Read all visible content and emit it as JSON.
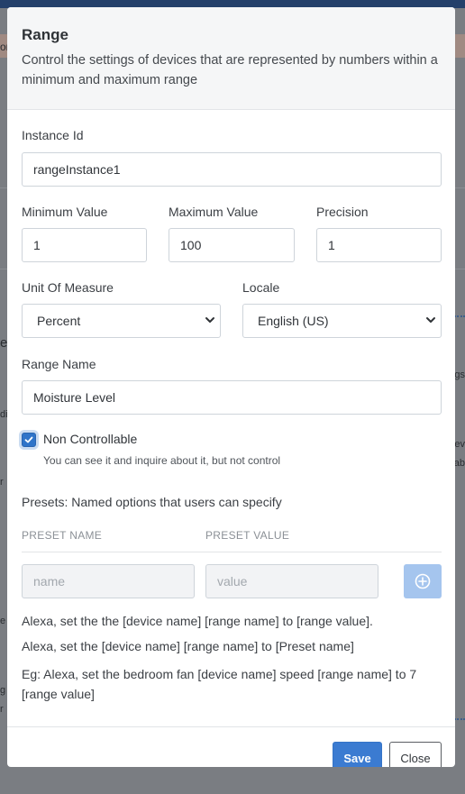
{
  "background": {
    "fragments": [
      "on",
      "e",
      "dit",
      "r",
      "e s",
      "g",
      "r",
      "gs",
      "ev",
      "ab"
    ]
  },
  "modal": {
    "title": "Range",
    "description": "Control the settings of devices that are represented by numbers within a minimum and maximum range"
  },
  "form": {
    "instance_id": {
      "label": "Instance Id",
      "value": "rangeInstance1"
    },
    "minimum_value": {
      "label": "Minimum Value",
      "value": "1"
    },
    "maximum_value": {
      "label": "Maximum Value",
      "value": "100"
    },
    "precision": {
      "label": "Precision",
      "value": "1"
    },
    "unit_of_measure": {
      "label": "Unit Of Measure",
      "selected": "Percent"
    },
    "locale": {
      "label": "Locale",
      "selected": "English (US)"
    },
    "range_name": {
      "label": "Range Name",
      "value": "Moisture Level"
    },
    "non_controllable": {
      "label": "Non Controllable",
      "checked": true,
      "help": "You can see it and inquire about it, but not control"
    }
  },
  "presets": {
    "heading": "Presets: Named options that users can specify",
    "columns": [
      "PRESET NAME",
      "PRESET VALUE"
    ],
    "name_placeholder": "name",
    "value_placeholder": "value",
    "add_icon": "plus-circle-icon"
  },
  "examples": [
    "Alexa, set the the [device name] [range name] to [range value].",
    "Alexa, set the [device name] [range name] to [Preset name]",
    "Eg: Alexa, set the bedroom fan [device name] speed [range name] to 7 [range value]"
  ],
  "footer": {
    "save_label": "Save",
    "close_label": "Close"
  },
  "colors": {
    "primary": "#3b7bd1",
    "checkbox": "#2f74c9",
    "add_button": "#a5c5ee"
  }
}
